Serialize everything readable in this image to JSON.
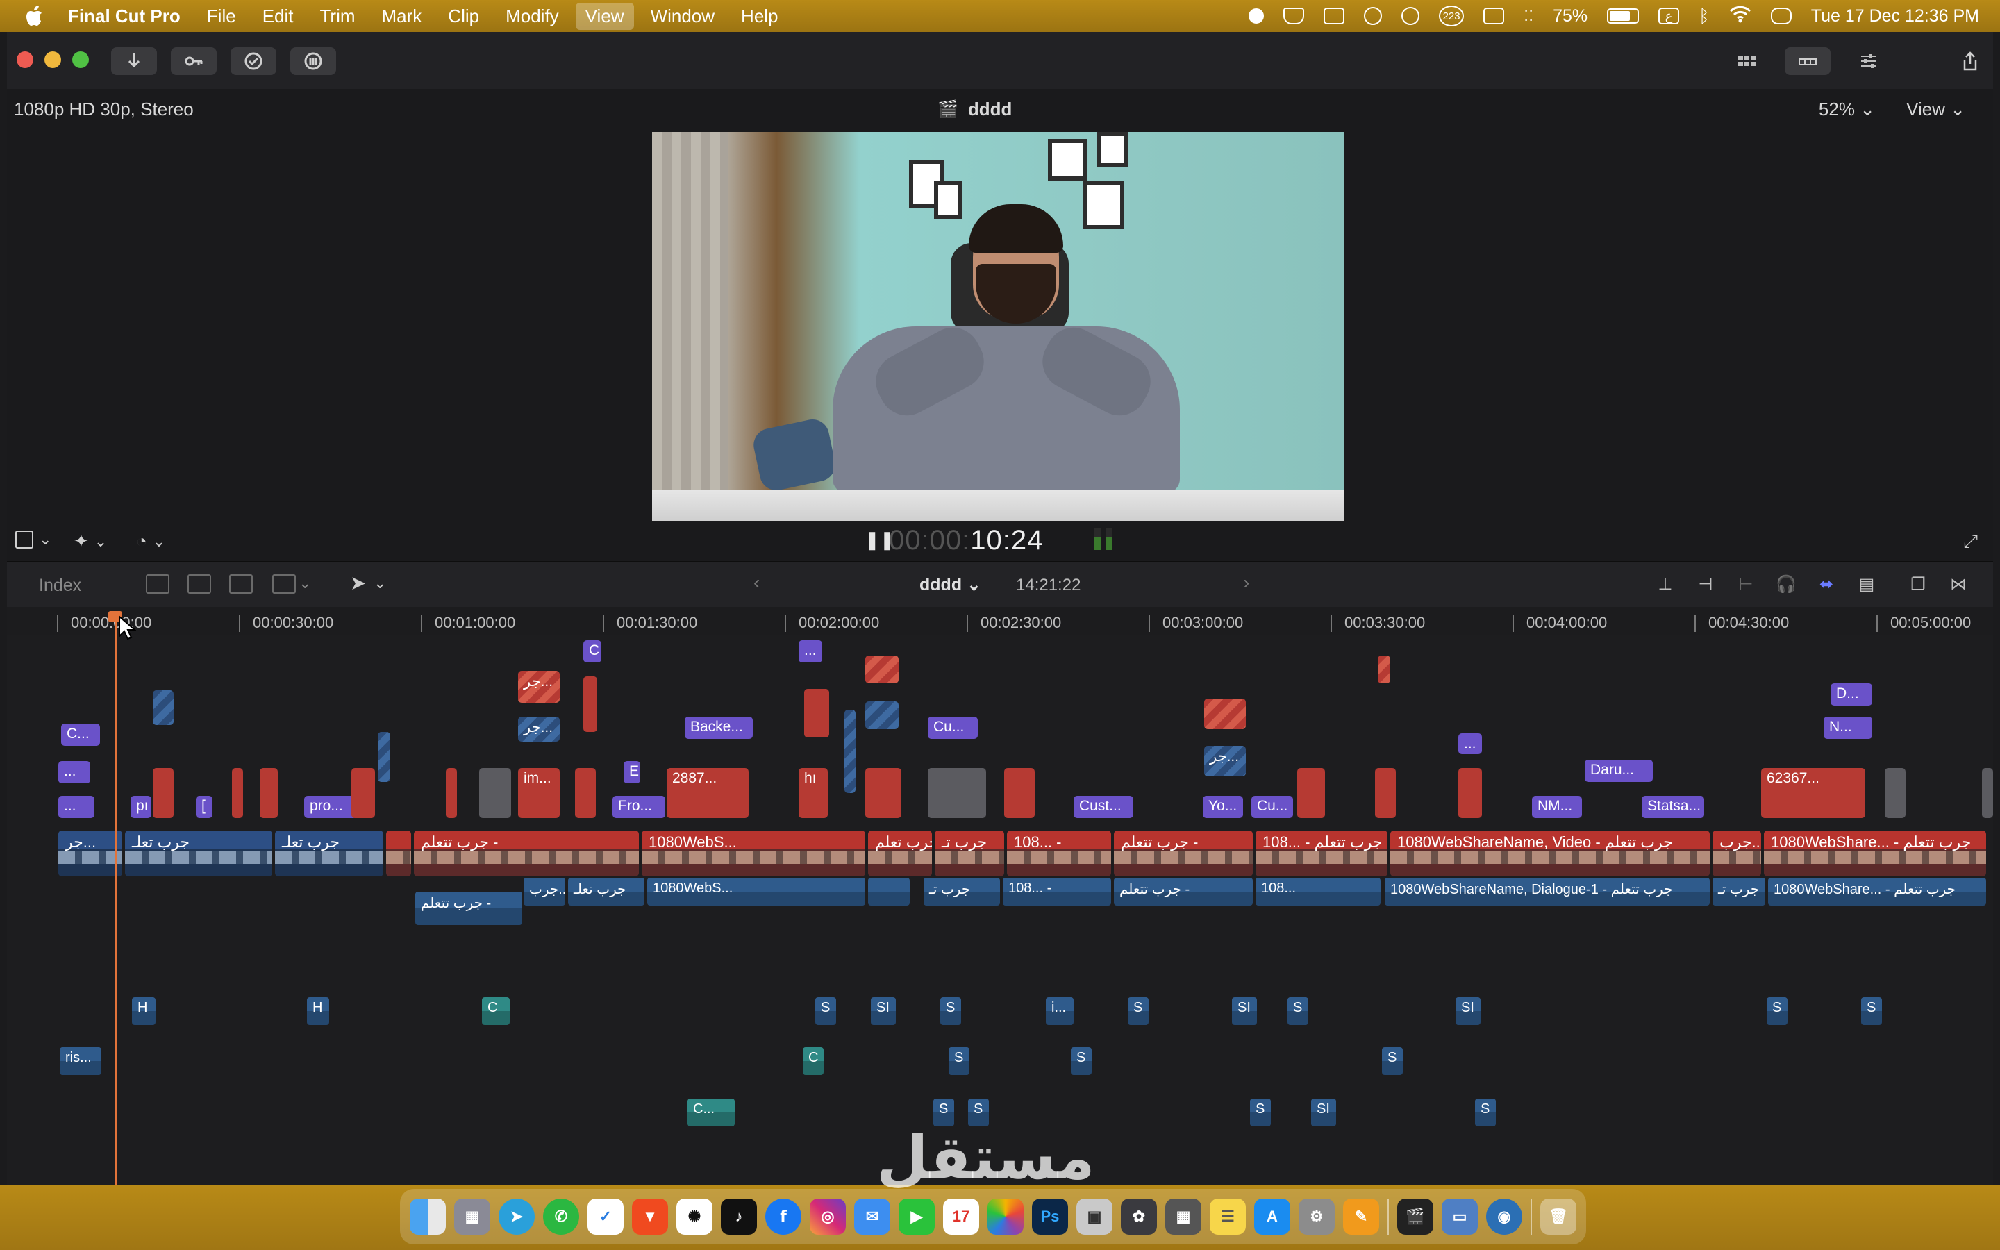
{
  "menubar": {
    "app_name": "Final Cut Pro",
    "items": [
      "File",
      "Edit",
      "Trim",
      "Mark",
      "Clip",
      "Modify",
      "View",
      "Window",
      "Help"
    ],
    "selected": "View",
    "battery_percent": "75%",
    "battery_level": 0.75,
    "notification_count": "223",
    "input_source": "ع",
    "datetime": "Tue 17 Dec  12:36 PM"
  },
  "viewer": {
    "format": "1080p HD 30p, Stereo",
    "project_title": "dddd",
    "zoom": "52%",
    "view_menu": "View",
    "timecode_dim": "00:00:",
    "timecode": "10:24"
  },
  "timeline_header": {
    "index_label": "Index",
    "project_name": "dddd",
    "duration": "14:21:22"
  },
  "ruler": {
    "labels": [
      "00:00:00:00",
      "00:00:30:00",
      "00:01:00:00",
      "00:01:30:00",
      "00:02:00:00",
      "00:02:30:00",
      "00:03:00:00",
      "00:03:30:00",
      "00:04:00:00",
      "00:04:30:00",
      "00:05:00:00"
    ]
  },
  "clips": {
    "c1": "C...",
    "c2": "...",
    "c3": "...",
    "c4": "pı",
    "c5": "[",
    "c6": "pro...",
    "c7": "C",
    "c8": "جر...",
    "c9": "جر...",
    "c10": "im...",
    "c11": "E",
    "c12": "Fro...",
    "c13": "Backe...",
    "c14": "2887...",
    "c15": "...",
    "c16": "hı",
    "c17": "Cu...",
    "c18": "Cust...",
    "c19": "جر...",
    "c20": "Yo...",
    "c21": "Cu...",
    "c22": "...",
    "c23": "Daru...",
    "c24": "NM...",
    "c25": "Statsa...",
    "c26": "62367...",
    "c27": "D...",
    "c28": "N..."
  },
  "storyline": {
    "s1": "جر...",
    "s2": "جرب تعلـ",
    "s3": "جرب تعلـ",
    "s4": "جرب تتعلم -",
    "s5": "1080WebS...",
    "s6": "جرب تعلم -",
    "s7": "جرب تـ",
    "s8": "108... -",
    "s9": "جرب تتعلم -",
    "s10": "108... - جرب تتعلم",
    "s11": "1080WebShareName, Video - جرب تتعلم",
    "s12": "جرب...",
    "s13": "1080WebShare... - جرب تتعلم"
  },
  "dialogue": {
    "d1": "جرب...",
    "d2": "جرب تعلـ",
    "d3": "1080WebS...",
    "d4": "جرب تعلم -",
    "d5": "جرب تـ",
    "d6": "108... -",
    "d7": "جرب تتعلم -",
    "d8": "108...",
    "d9": "1080WebShareName, Dialogue-1 - جرب تتعلم",
    "d10": "جرب تـ",
    "d11": "1080WebShare... - جرب تتعلم",
    "d12": "جرب تتعلم -"
  },
  "audio": {
    "a1": "H",
    "a2": "H",
    "a3": "C",
    "a4": "S",
    "a5": "SI",
    "a6": "S",
    "a7": "i...",
    "a8": "S",
    "a9": "SI",
    "a10": "S",
    "a11": "SI",
    "a12": "S",
    "a13": "S",
    "a14": "ris...",
    "a15": "C",
    "a16": "S",
    "a17": "S",
    "a18": "S",
    "a19": "C...",
    "a20": "S",
    "a21": "S",
    "a22": "S",
    "a23": "SI",
    "a24": "S"
  },
  "watermark": "مستقل",
  "dock": {
    "calendar_day": "17",
    "apps": [
      "Finder",
      "Launchpad",
      "Telegram",
      "WhatsApp",
      "Tasks",
      "Brave",
      "ChatGPT",
      "TikTok",
      "Facebook",
      "Instagram",
      "Mail",
      "FaceTime",
      "Calendar",
      "Photos",
      "Photoshop",
      "Preview",
      "Davinci",
      "Calculator",
      "Notes",
      "App Store",
      "System Settings",
      "Pages",
      "Final Cut Pro",
      "Keynote",
      "Quick Look",
      "Trash"
    ]
  },
  "colors": {
    "menubar": "#b88a17",
    "accent_purple": "#6a52c9",
    "clip_red": "#b63a33",
    "clip_blue": "#2c4d7b",
    "playhead": "#e2733a"
  }
}
